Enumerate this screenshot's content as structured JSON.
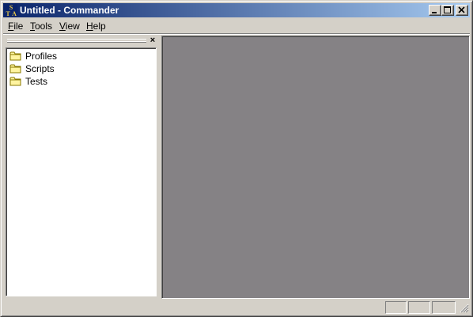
{
  "window": {
    "title": "Untitled - Commander",
    "app_icon": "sta-app-icon",
    "title_gradient": [
      "#0a246a",
      "#a6caf0"
    ],
    "controls": [
      {
        "name": "minimize-button",
        "icon": "minimize-icon"
      },
      {
        "name": "maximize-button",
        "icon": "maximize-icon"
      },
      {
        "name": "close-button",
        "icon": "close-icon"
      }
    ]
  },
  "menu": {
    "items": [
      {
        "accel": "F",
        "rest": "ile"
      },
      {
        "accel": "T",
        "rest": "ools"
      },
      {
        "accel": "V",
        "rest": "iew"
      },
      {
        "accel": "H",
        "rest": "elp"
      }
    ]
  },
  "dock": {
    "close_glyph": "×",
    "tree": [
      {
        "label": "Profiles",
        "icon": "folder-icon"
      },
      {
        "label": "Scripts",
        "icon": "folder-icon"
      },
      {
        "label": "Tests",
        "icon": "folder-icon"
      }
    ]
  },
  "workspace": {
    "background": "#858285"
  },
  "statusbar": {
    "panels": [
      "",
      "",
      ""
    ]
  }
}
